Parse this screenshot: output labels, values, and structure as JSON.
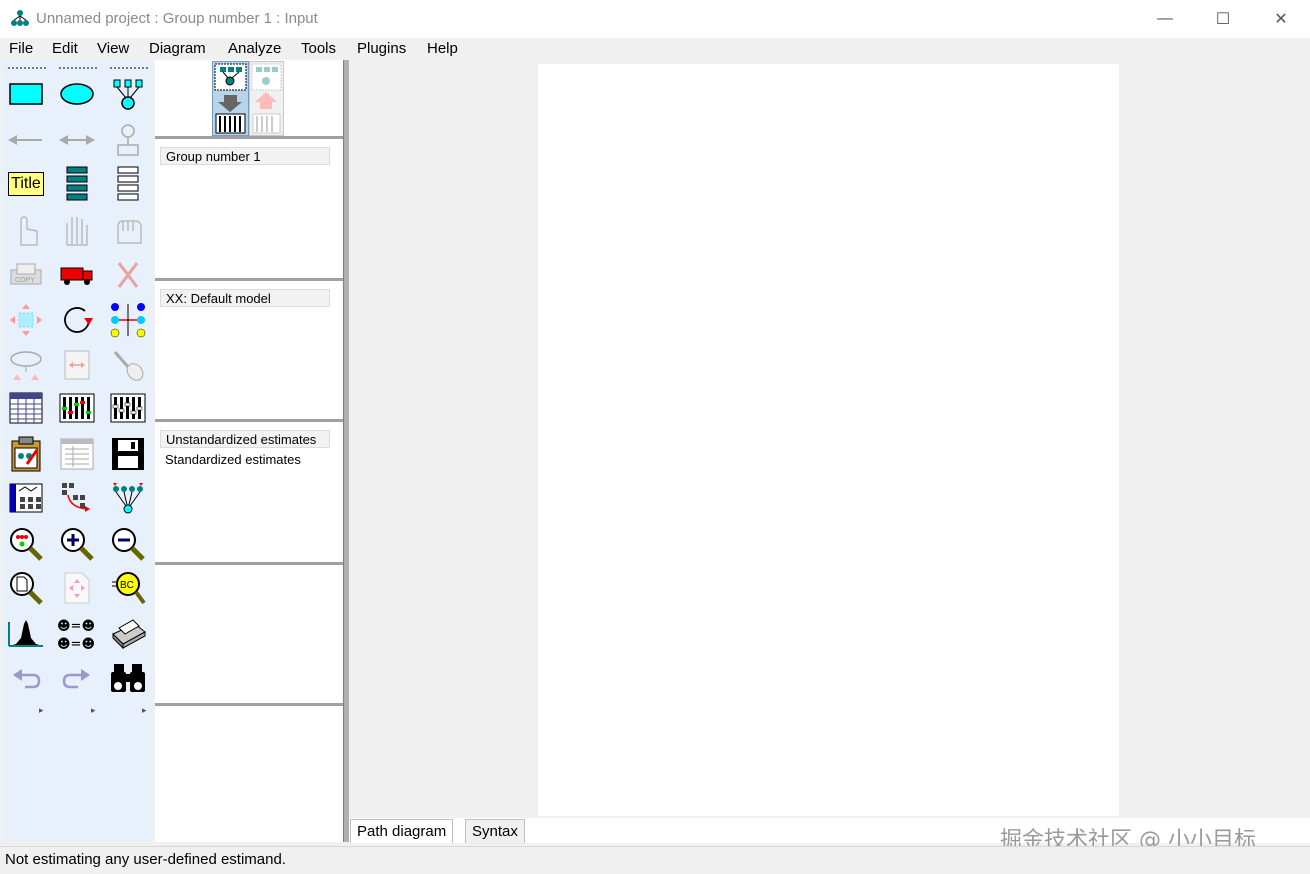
{
  "window": {
    "title": "Unnamed project : Group number 1 : Input",
    "controls": {
      "minimize": "—",
      "maximize": "☐",
      "close": "✕"
    }
  },
  "menu": [
    "File",
    "Edit",
    "View",
    "Diagram",
    "Analyze",
    "Tools",
    "Plugins",
    "Help"
  ],
  "toolbox": {
    "title_tool_label": "Title",
    "more_glyph": "▸"
  },
  "mid_panel": {
    "groups": [
      "Group number 1"
    ],
    "models": [
      "XX: Default model"
    ],
    "estimates": [
      "Unstandardized estimates",
      "Standardized estimates"
    ]
  },
  "tabs": [
    "Path diagram",
    "Syntax"
  ],
  "status": "Not estimating any user-defined estimand.",
  "watermark": "掘金技术社区 @ 小小目标",
  "colors": {
    "accent_cyan": "#00ffff",
    "toolbox_bg": "#e8f0fc",
    "icon_teal": "#008080"
  }
}
